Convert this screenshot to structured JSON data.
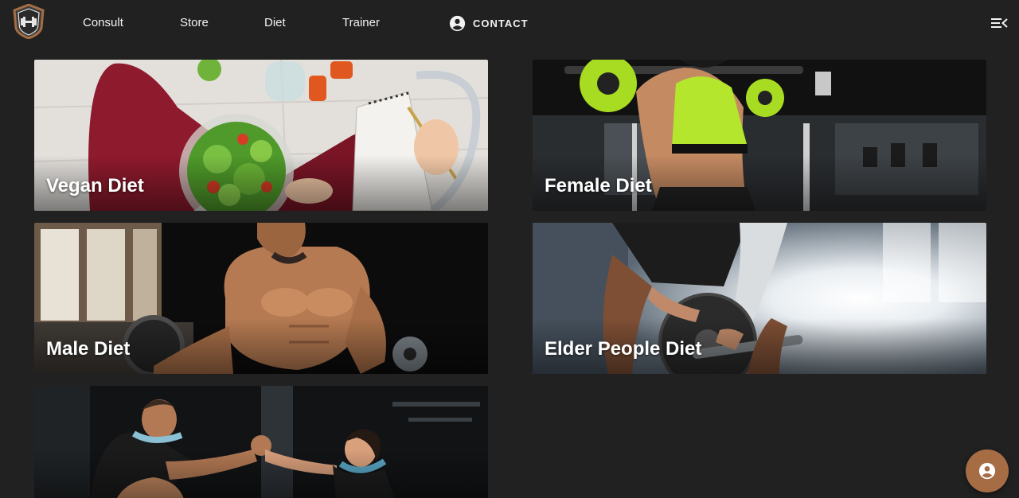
{
  "nav": {
    "logo_icon": "dumbbell-shield-icon",
    "links": [
      "Consult",
      "Store",
      "Diet",
      "Trainer"
    ],
    "contact_label": "CONTACT",
    "contact_icon": "account-circle-icon",
    "menu_icon": "menu-collapse-icon"
  },
  "cards": [
    {
      "title": "Vegan Diet"
    },
    {
      "title": "Female Diet"
    },
    {
      "title": "Male Diet"
    },
    {
      "title": "Elder People Diet"
    },
    {
      "title": ""
    }
  ],
  "fab": {
    "icon": "account-circle-icon"
  },
  "colors": {
    "background": "#212121",
    "nav_text": "#f2f2f2",
    "logo_ring": "#a66d45",
    "fab": "#a66d45",
    "female_accent": "#b7f02c"
  }
}
